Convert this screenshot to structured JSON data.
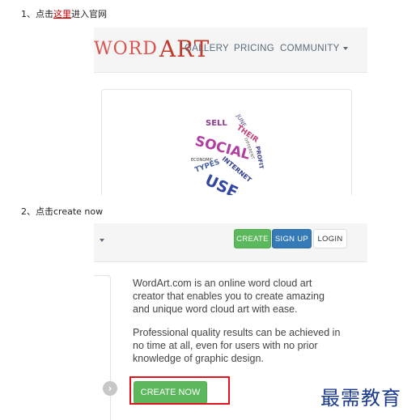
{
  "steps": {
    "step1": {
      "prefix": "1、点击",
      "link": "这里",
      "suffix": "进入官网"
    },
    "step2": {
      "text": "2、点击create now"
    }
  },
  "shot1": {
    "logo": {
      "part1": "WORD",
      "part2": "ART"
    },
    "nav": {
      "gallery": "GALLERY",
      "pricing": "PRICING",
      "community": "COMMUNITY"
    },
    "cloud_words": [
      "SOCIAL",
      "USE",
      "JUNE",
      "SELL",
      "THEIR",
      "INTERNET",
      "PROFIT",
      "TYPES",
      "ECONOMIC",
      "DIFFERENT"
    ]
  },
  "shot2": {
    "buttons": {
      "create": "CREATE",
      "signup": "SIGN UP",
      "login": "LOGIN"
    },
    "description": [
      "WordArt.com is an online word cloud art creator that enables you to create amazing and unique word cloud art with ease.",
      "Professional quality results can be achieved in no time at all, even for users with no prior knowledge of graphic design."
    ],
    "create_now": "CREATE NOW",
    "next_arrow": "›"
  },
  "watermark": "最需教育",
  "colors": {
    "link_red": "#cc0000",
    "green": "#5cb85c",
    "blue": "#337ab7",
    "highlight_red": "#e0141e",
    "watermark_blue": "#1a3a8f"
  },
  "icons": [
    "chevron-down-icon",
    "chevron-right-icon"
  ]
}
